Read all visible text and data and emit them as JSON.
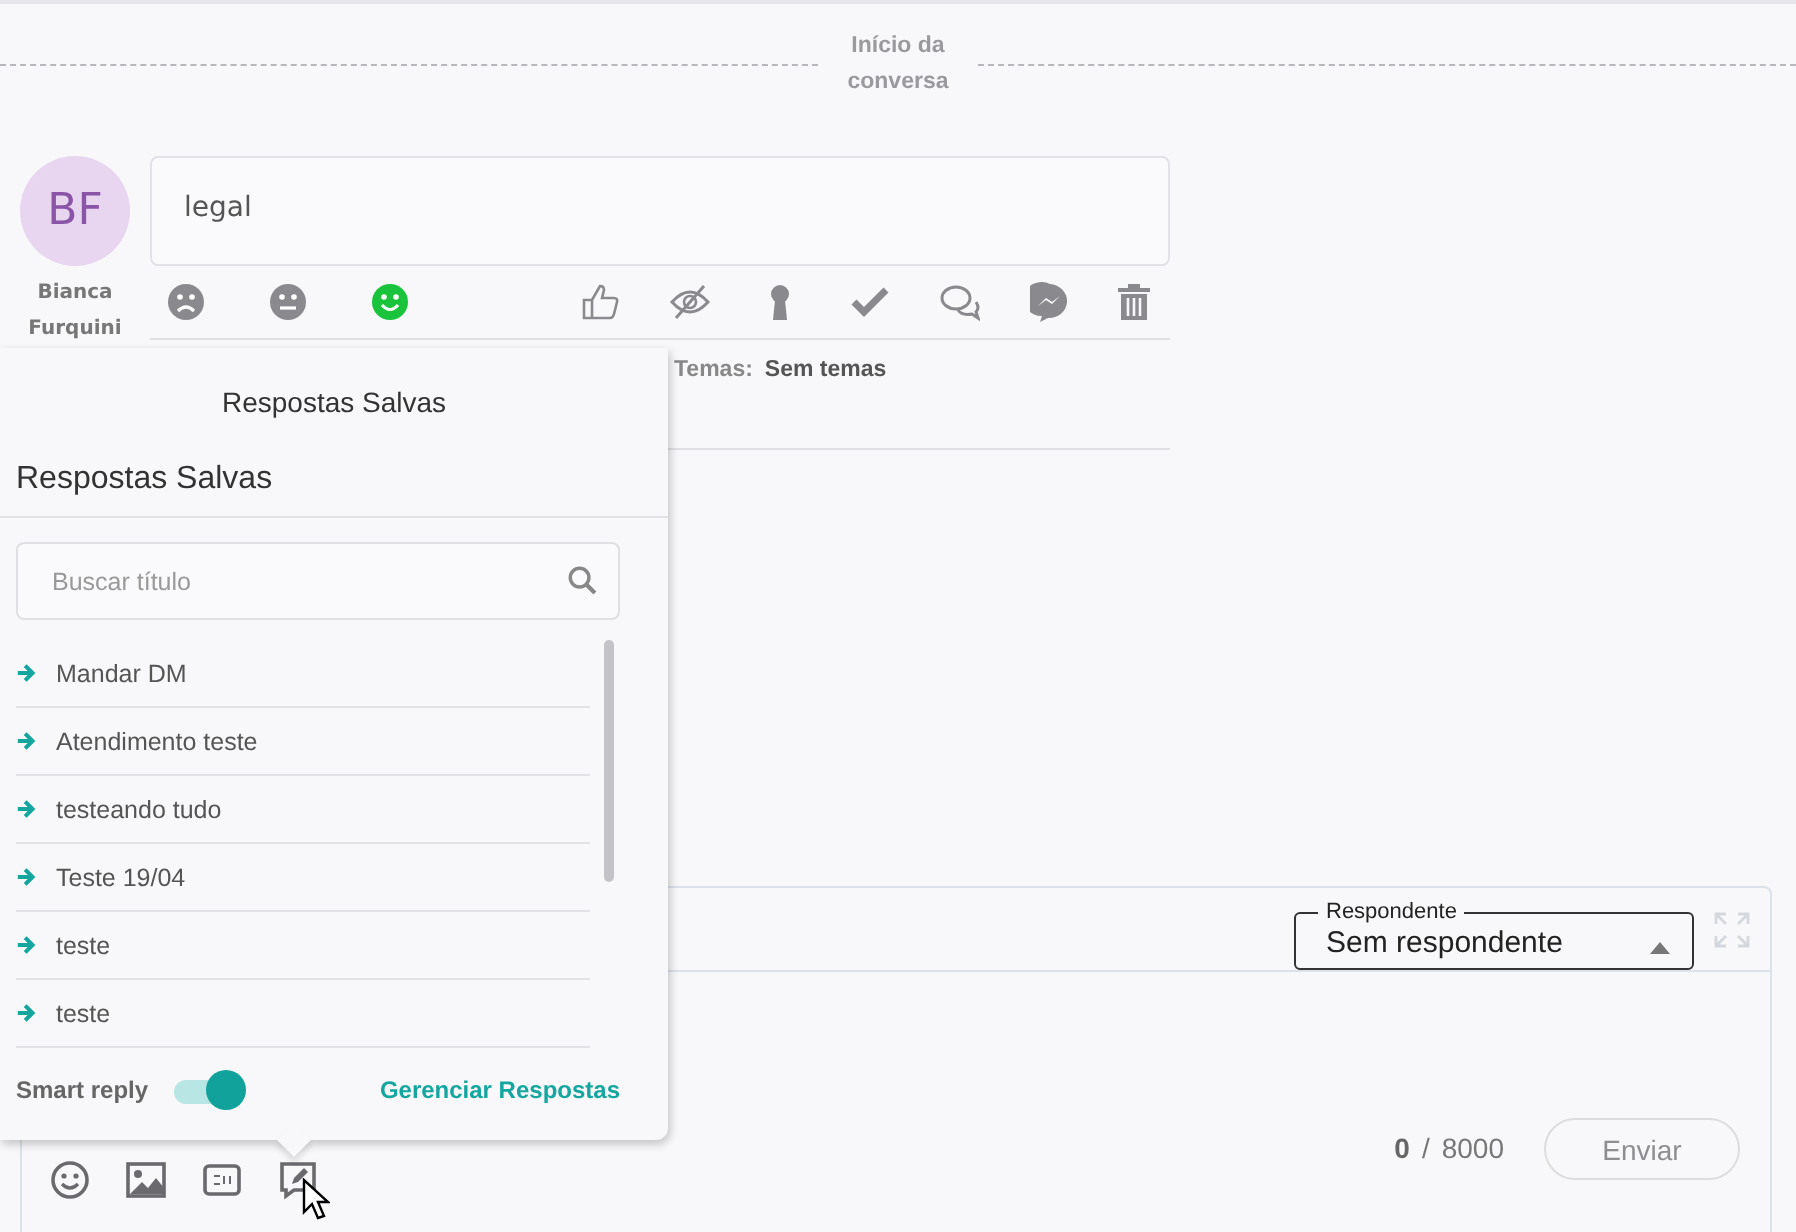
{
  "conversation_start": "Início da conversa",
  "message": {
    "author_initials": "BF",
    "author_name": "Bianca Furquini",
    "text": "legal",
    "sentiments": [
      {
        "kind": "negative",
        "selected": false
      },
      {
        "kind": "neutral",
        "selected": false
      },
      {
        "kind": "positive",
        "selected": true
      }
    ]
  },
  "topics": {
    "label": "Temas:",
    "value": "Sem temas"
  },
  "saved_replies": {
    "tooltip_title": "Respostas Salvas",
    "title": "Respostas Salvas",
    "search": {
      "placeholder": "Buscar título"
    },
    "items": [
      "Mandar DM",
      "Atendimento teste",
      "testeando tudo",
      "Teste 19/04",
      "teste",
      "teste"
    ],
    "smart_reply": {
      "label": "Smart reply",
      "on": true
    },
    "manage_link": "Gerenciar Respostas"
  },
  "composer": {
    "responder": {
      "label": "Respondente",
      "value": "Sem respondente"
    },
    "count": "0",
    "separator": "/",
    "max": "8000",
    "send_button": {
      "label": "Enviar",
      "disabled": true
    }
  }
}
